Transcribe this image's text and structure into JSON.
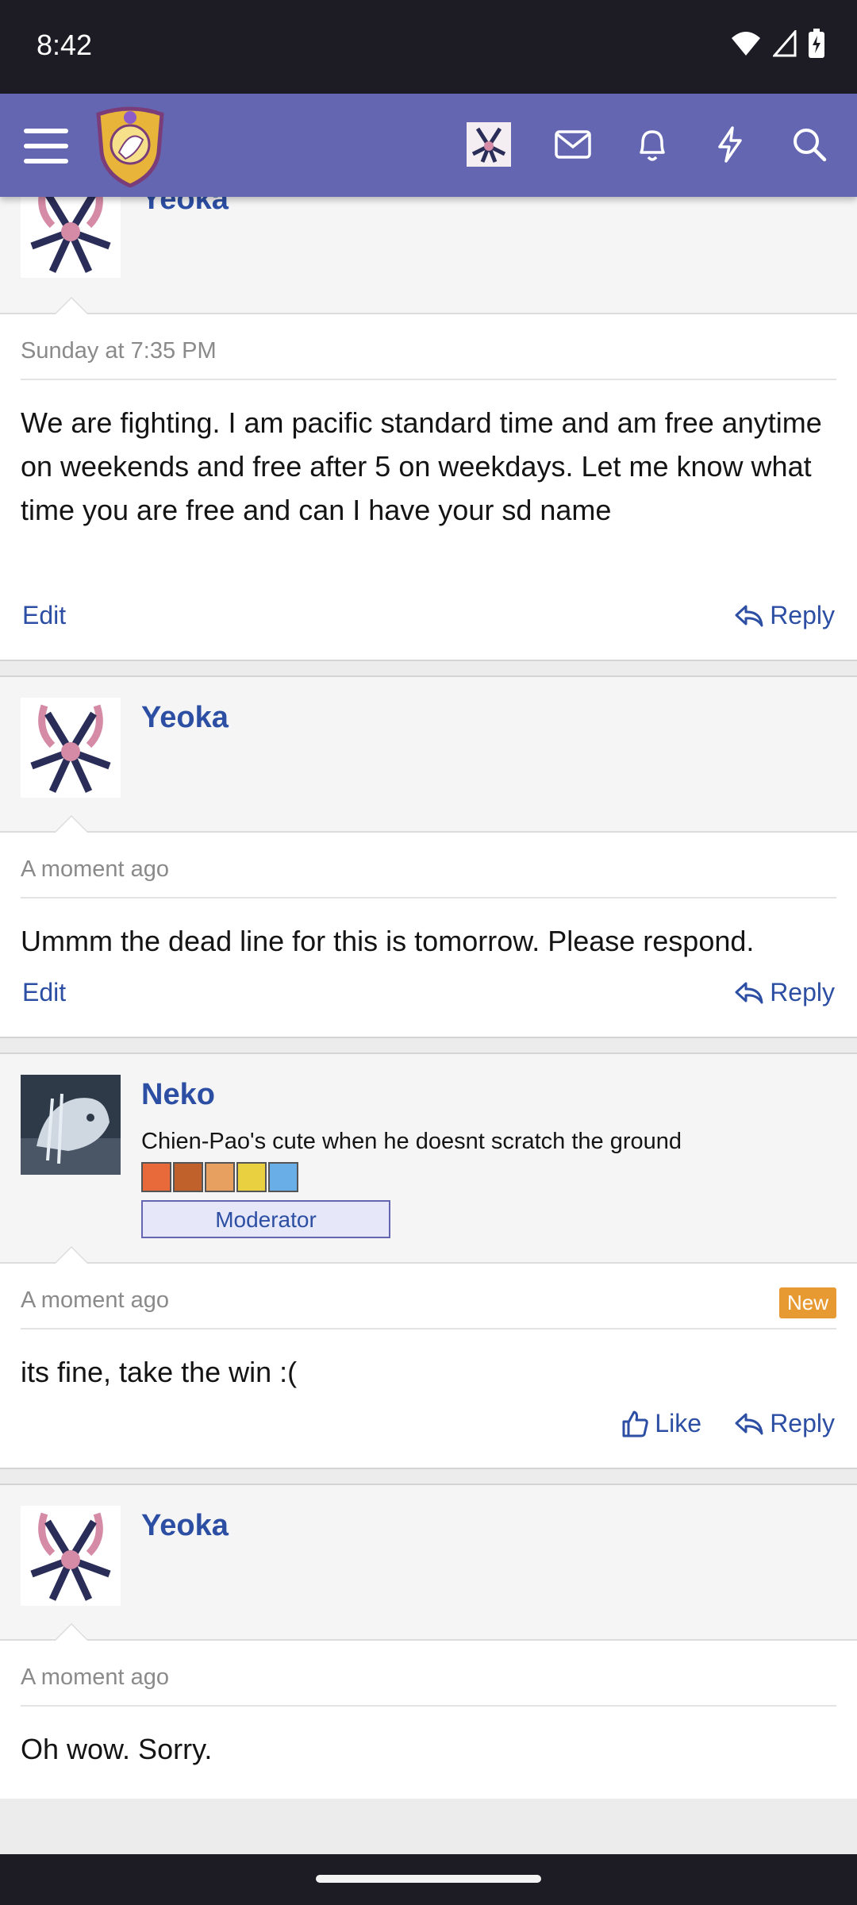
{
  "status_bar": {
    "time": "8:42"
  },
  "nav": {
    "icons": [
      "menu-icon",
      "site-logo",
      "user-avatar",
      "envelope-icon",
      "bell-icon",
      "lightning-icon",
      "search-icon"
    ]
  },
  "posts": [
    {
      "username": "Yeoka",
      "timestamp": "Sunday at 7:35 PM",
      "message": "We are fighting. I am pacific standard time and am free anytime on weekends and free after 5 on weekdays. Let me know what time you are free and can I have your sd name",
      "edit_label": "Edit",
      "reply_label": "Reply"
    },
    {
      "username": "Yeoka",
      "timestamp": "A moment ago",
      "message": "Ummm the dead line for this is tomorrow. Please respond.",
      "edit_label": "Edit",
      "reply_label": "Reply"
    },
    {
      "username": "Neko",
      "user_title": "Chien-Pao's cute when he doesnt scratch the ground",
      "role_badge": "Moderator",
      "timestamp": "A moment ago",
      "new_badge": "New",
      "message": "its fine, take the win :(",
      "like_label": "Like",
      "reply_label": "Reply"
    },
    {
      "username": "Yeoka",
      "timestamp": "A moment ago",
      "message": "Oh wow. Sorry."
    }
  ],
  "colors": {
    "nav_bg": "#6466b2",
    "link": "#2c4ea3",
    "new_badge": "#e79a32",
    "status_bar_bg": "#1d1b24"
  }
}
